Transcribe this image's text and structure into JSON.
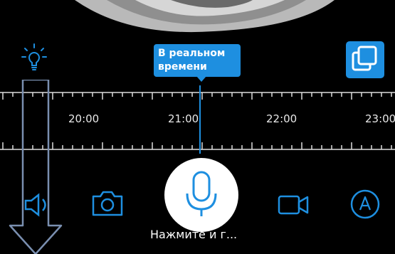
{
  "live_tooltip": {
    "text": "В реальном времени"
  },
  "timeline": {
    "labels": [
      "20:00",
      "21:00",
      "22:00",
      "23:00"
    ]
  },
  "mic": {
    "hint": "Нажмите и г..."
  },
  "icons": {
    "bulb": "lightbulb-icon",
    "multi_view": "multi-view-icon",
    "speaker": "speaker-icon",
    "camera": "camera-icon",
    "video": "video-camera-icon",
    "auto": "auto-mode-icon",
    "mic": "microphone-icon",
    "arrow": "down-arrow-overlay"
  },
  "colors": {
    "accent": "#1e8fe0",
    "background": "#000000"
  }
}
